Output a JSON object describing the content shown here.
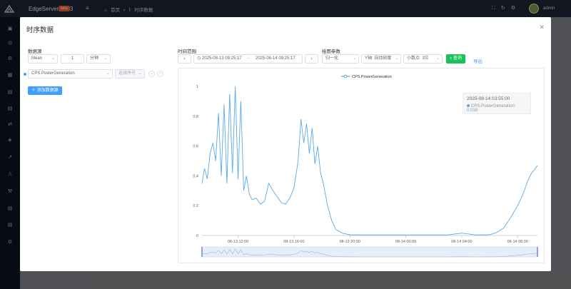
{
  "app": {
    "title": "EdgeServer 2.3.3",
    "badge": "beta",
    "breadcrumb": [
      "首页",
      "时序数据"
    ],
    "user": "admin"
  },
  "dialog": {
    "title": "时序数据",
    "close_icon": "close-icon",
    "datasource": {
      "label": "数据源",
      "aggregate": "Mean",
      "interval_value": "1",
      "interval_unit": "分钟",
      "item_name": "CPS.PowerGeneration",
      "alias_placeholder": "选择序号",
      "add_button": "添加数据源"
    },
    "time_range": {
      "label": "时间范围",
      "start": "2025-08-13 09:25:17",
      "separator": "-",
      "end": "2025-08-14 09:25:17"
    },
    "plot_params": {
      "label": "绘图参数",
      "normalize": "归一化",
      "y_axis": "Y轴: 自动刻度",
      "decimals": "小数点: 3位",
      "query_button": "查询",
      "export_link": "导出"
    },
    "tooltip": {
      "time": "2025-08-14 03:55:00",
      "value_line": "CPS.PowerGeneration: 0.016"
    }
  },
  "colors": {
    "primary": "#409eff",
    "success": "#19c35a",
    "line": "#5aa9e6"
  },
  "chart_data": {
    "type": "line",
    "legend": [
      "CPS.PowerGeneration"
    ],
    "y_ticks": [
      "0",
      "0.2",
      "0.4",
      "0.6",
      "0.8",
      "1"
    ],
    "ylim": [
      0,
      1
    ],
    "x_ticks": [
      "08-13 12:00",
      "08-13 16:00",
      "08-13 20:00",
      "08-14 00:00",
      "08-14 04:00",
      "08-14 08:00"
    ],
    "x_hours_start": 9.42,
    "x_hours_end": 33.42,
    "series": [
      {
        "name": "CPS.PowerGeneration",
        "points": [
          [
            9.42,
            0.35
          ],
          [
            9.6,
            0.45
          ],
          [
            9.8,
            0.38
          ],
          [
            10.0,
            0.55
          ],
          [
            10.2,
            0.62
          ],
          [
            10.4,
            0.5
          ],
          [
            10.6,
            0.82
          ],
          [
            10.8,
            0.4
          ],
          [
            11.0,
            0.88
          ],
          [
            11.2,
            0.35
          ],
          [
            11.4,
            0.95
          ],
          [
            11.6,
            0.42
          ],
          [
            11.8,
            1.0
          ],
          [
            12.0,
            0.38
          ],
          [
            12.2,
            0.9
          ],
          [
            12.4,
            0.3
          ],
          [
            12.6,
            0.4
          ],
          [
            12.8,
            0.28
          ],
          [
            13.0,
            0.24
          ],
          [
            13.3,
            0.25
          ],
          [
            13.6,
            0.21
          ],
          [
            13.9,
            0.23
          ],
          [
            14.2,
            0.35
          ],
          [
            14.5,
            0.3
          ],
          [
            14.8,
            0.26
          ],
          [
            15.1,
            0.22
          ],
          [
            15.4,
            0.21
          ],
          [
            15.7,
            0.25
          ],
          [
            16.0,
            0.32
          ],
          [
            16.3,
            0.5
          ],
          [
            16.5,
            0.78
          ],
          [
            16.7,
            0.62
          ],
          [
            16.9,
            0.75
          ],
          [
            17.1,
            0.55
          ],
          [
            17.3,
            0.72
          ],
          [
            17.5,
            0.48
          ],
          [
            17.7,
            0.6
          ],
          [
            17.9,
            0.42
          ],
          [
            18.1,
            0.35
          ],
          [
            18.4,
            0.2
          ],
          [
            18.7,
            0.1
          ],
          [
            19.0,
            0.04
          ],
          [
            19.5,
            0.015
          ],
          [
            20.0,
            0.005
          ],
          [
            21.0,
            0.004
          ],
          [
            22.0,
            0.004
          ],
          [
            23.0,
            0.004
          ],
          [
            24.0,
            0.004
          ],
          [
            25.0,
            0.004
          ],
          [
            26.0,
            0.004
          ],
          [
            27.0,
            0.004
          ],
          [
            28.0,
            0.016
          ],
          [
            29.0,
            0.004
          ],
          [
            30.0,
            0.005
          ],
          [
            30.5,
            0.02
          ],
          [
            31.0,
            0.05
          ],
          [
            31.5,
            0.12
          ],
          [
            32.0,
            0.2
          ],
          [
            32.4,
            0.28
          ],
          [
            32.7,
            0.36
          ],
          [
            33.0,
            0.42
          ],
          [
            33.2,
            0.44
          ],
          [
            33.42,
            0.47
          ]
        ]
      }
    ]
  }
}
